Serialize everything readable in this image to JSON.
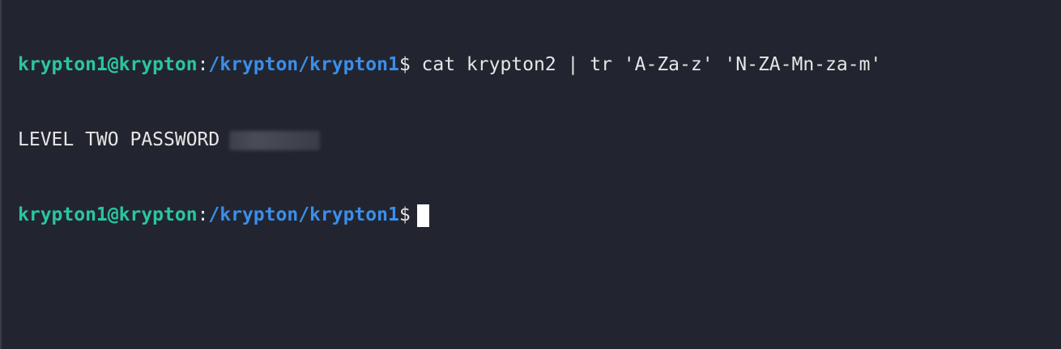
{
  "terminal": {
    "lines": [
      {
        "user_host": "krypton1@krypton",
        "colon": ":",
        "path": "/krypton/krypton1",
        "dollar": "$",
        "command": " cat krypton2 | tr 'A-Za-z' 'N-ZA-Mn-za-m'"
      },
      {
        "output": "LEVEL TWO PASSWORD"
      },
      {
        "user_host": "krypton1@krypton",
        "colon": ":",
        "path": "/krypton/krypton1",
        "dollar": "$",
        "command": ""
      }
    ]
  },
  "colors": {
    "background": "#22252f",
    "user_host": "#2bc5a1",
    "path": "#3b8eea",
    "text": "#e6e6e6",
    "cursor": "#ffffff"
  }
}
